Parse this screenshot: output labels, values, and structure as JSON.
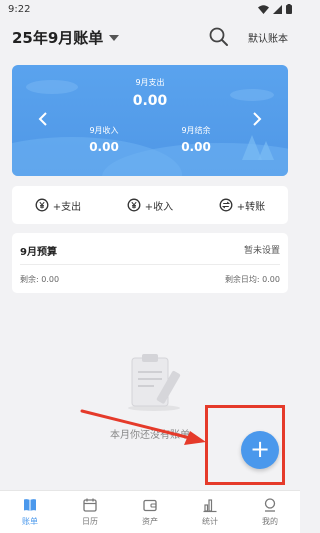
{
  "status_bar": {
    "time": "9:22"
  },
  "header": {
    "title": "25年9月账单",
    "search_icon": "search-icon",
    "ledger": "默认账本"
  },
  "summary": {
    "expense_label": "9月支出",
    "expense_value": "0.00",
    "income_label": "9月收入",
    "income_value": "0.00",
    "balance_label": "9月结余",
    "balance_value": "0.00"
  },
  "actions": [
    {
      "label": "+支出",
      "icon": "expense-icon"
    },
    {
      "label": "+收入",
      "icon": "income-icon"
    },
    {
      "label": "+转账",
      "icon": "transfer-icon"
    }
  ],
  "budget": {
    "title": "9月预算",
    "status": "暂未设置",
    "remaining": "剩余: 0.00",
    "daily_remaining": "剩余日均: 0.00"
  },
  "empty_state": {
    "text": "本月你还没有账单"
  },
  "fab": {
    "label": "+"
  },
  "tabs": [
    {
      "label": "账单",
      "icon": "bill-icon",
      "active": true
    },
    {
      "label": "日历",
      "icon": "calendar-icon",
      "active": false
    },
    {
      "label": "资产",
      "icon": "wallet-icon",
      "active": false
    },
    {
      "label": "统计",
      "icon": "chart-icon",
      "active": false
    },
    {
      "label": "我的",
      "icon": "profile-icon",
      "active": false
    }
  ],
  "colors": {
    "accent": "#4a98ec",
    "card_blue": "#5aa3ee",
    "highlight_red": "#e53a2a"
  }
}
